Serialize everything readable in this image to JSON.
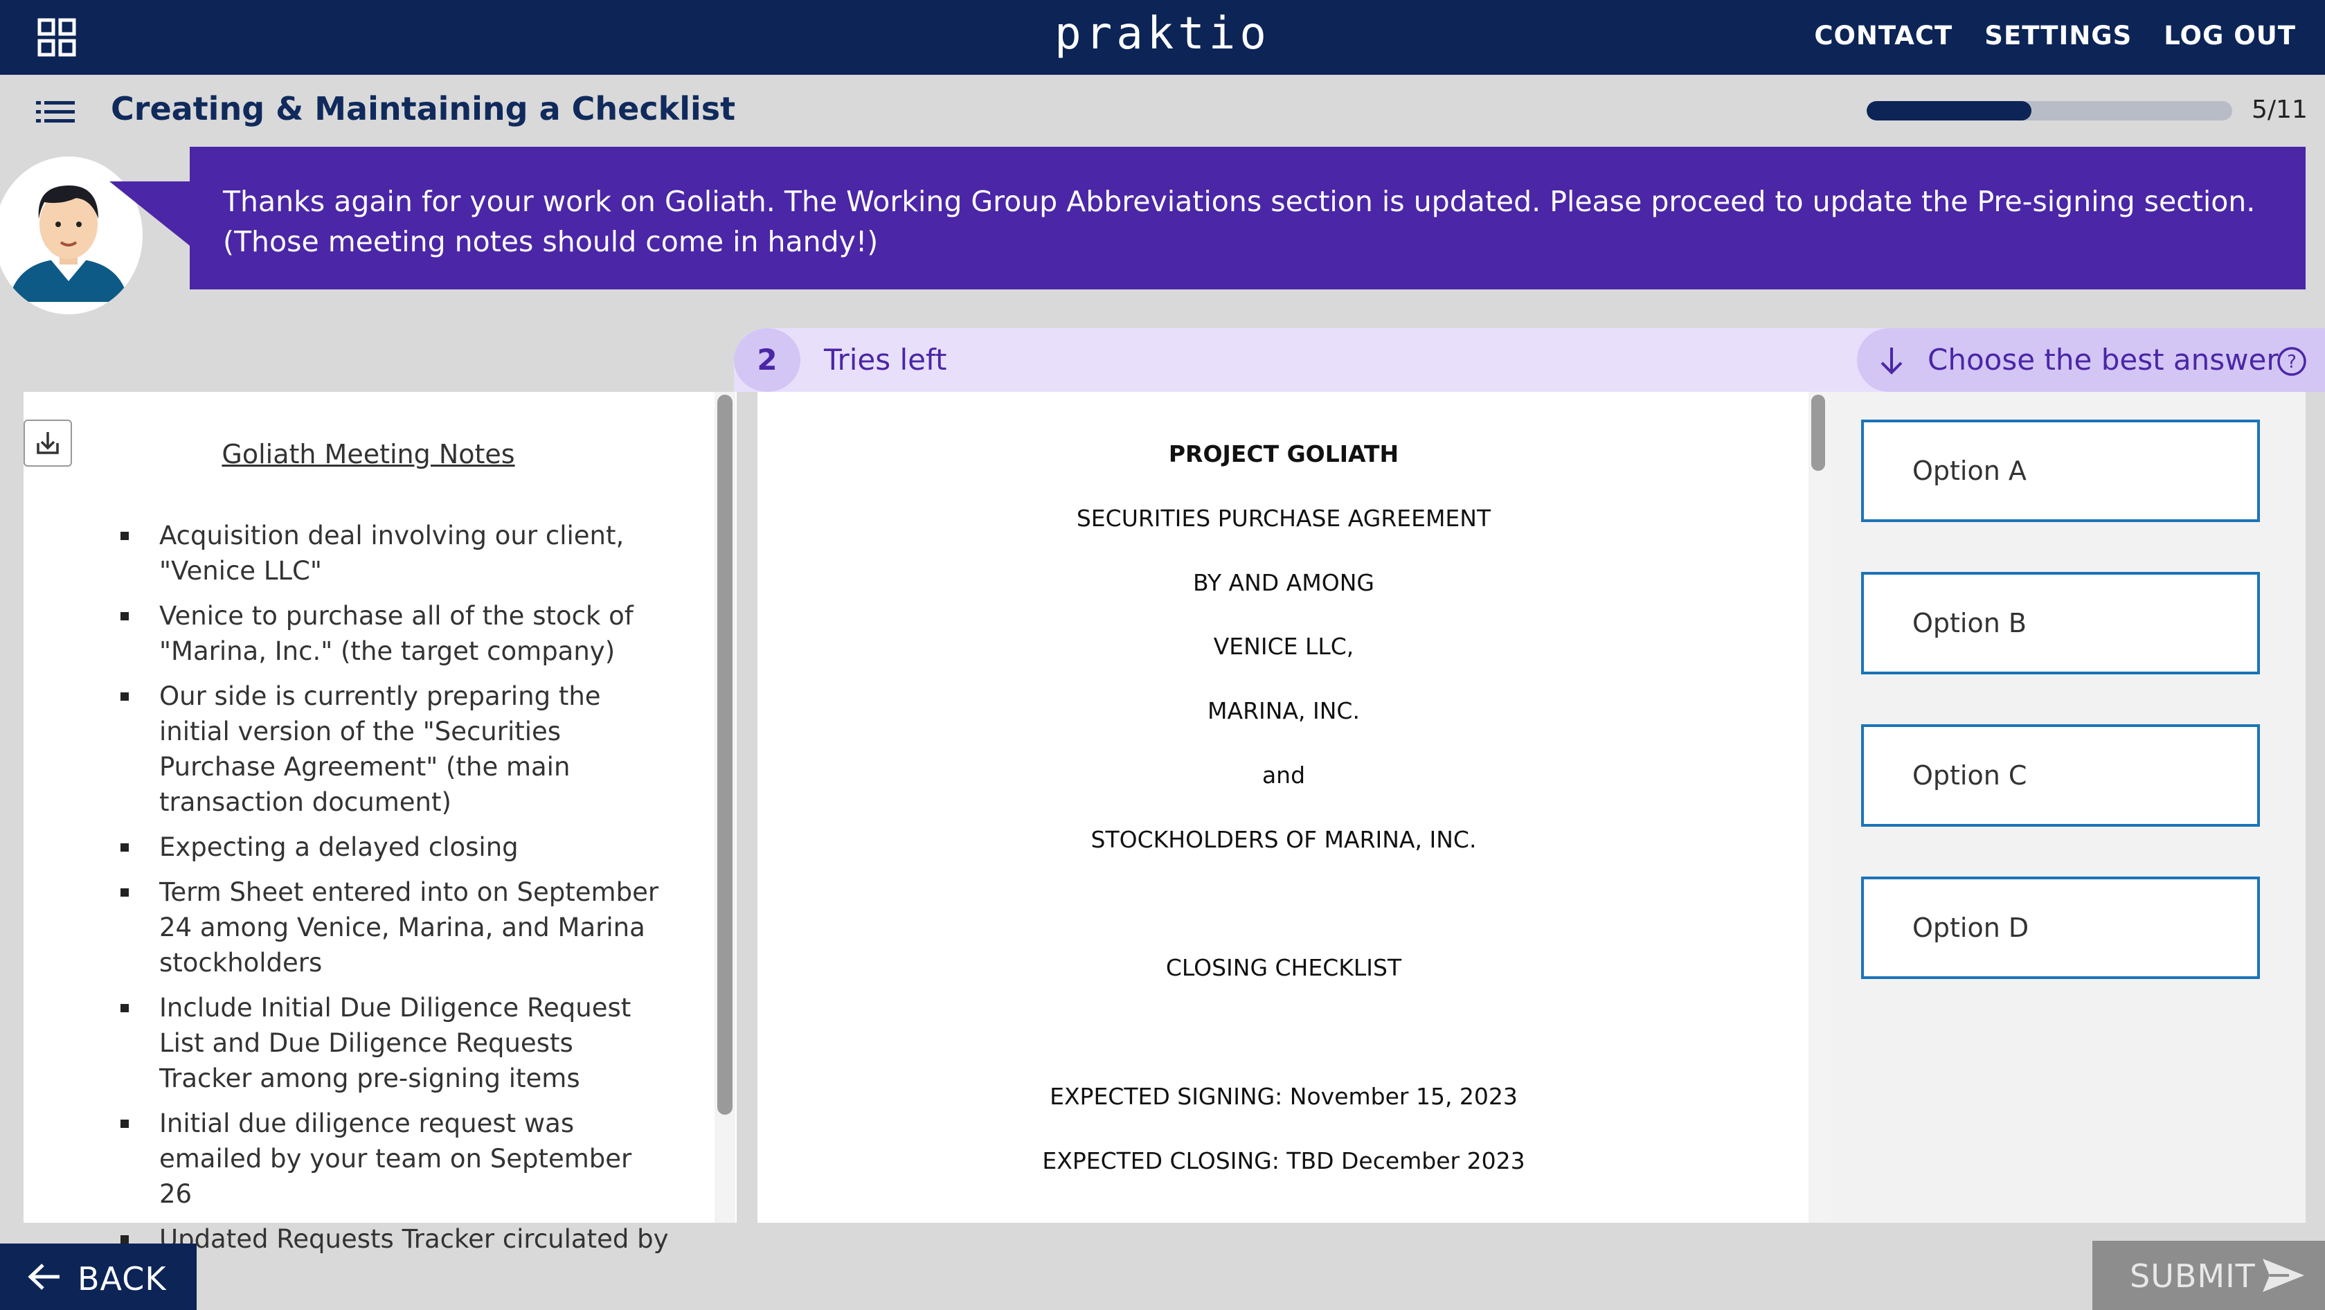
{
  "header": {
    "logo": "praktio",
    "nav": [
      "CONTACT",
      "SETTINGS",
      "LOG OUT"
    ]
  },
  "lesson": {
    "title": "Creating & Maintaining a Checklist",
    "progress_text": "5/11",
    "progress_fraction": 0.45
  },
  "message": "Thanks again for your work on Goliath. The Working Group Abbreviations section is updated. Please proceed to update the Pre-signing section. (Those meeting notes should come in handy!)",
  "question": {
    "tries_count": "2",
    "tries_label": "Tries left",
    "choose_label": "Choose the best answer"
  },
  "notes": {
    "title": "Goliath Meeting Notes",
    "items": [
      "Acquisition deal involving our client, \"Venice LLC\"",
      "Venice to purchase all of the stock of \"Marina, Inc.\" (the target company)",
      "Our side is currently preparing the initial version of the \"Securities Purchase Agreement\" (the main transaction document)",
      "Expecting a delayed closing",
      "Term Sheet entered into on September 24 among Venice, Marina, and Marina stockholders",
      "Include Initial Due Diligence Request List and Due Diligence Requests Tracker among pre-signing items",
      "Initial due diligence request was emailed by your team on September 26",
      "Updated Requests Tracker circulated by"
    ]
  },
  "document": {
    "lines": [
      "PROJECT GOLIATH",
      "SECURITIES PURCHASE AGREEMENT",
      "BY AND AMONG",
      "VENICE LLC,",
      "MARINA, INC.",
      "and",
      "STOCKHOLDERS OF MARINA, INC.",
      "CLOSING CHECKLIST",
      "EXPECTED SIGNING: November 15, 2023",
      "EXPECTED CLOSING: TBD December 2023"
    ]
  },
  "options": [
    "Option A",
    "Option B",
    "Option C",
    "Option D"
  ],
  "footer": {
    "back_label": "BACK",
    "submit_label": "SUBMIT"
  },
  "colors": {
    "navy": "#0c2456",
    "purple": "#4b26a6",
    "lavender": "#e8e0fb",
    "option_border": "#1b74b8",
    "submit_disabled": "#8d8d8d"
  }
}
